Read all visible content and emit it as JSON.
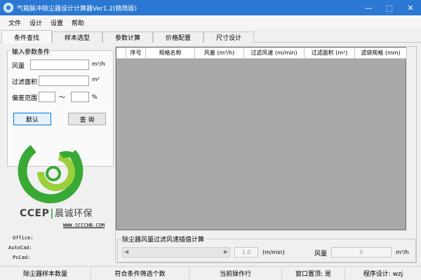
{
  "window": {
    "title": "气箱脉冲除尘器设计计算器Ver1.2(精简版)",
    "minimize_glyph": "—",
    "maximize_glyph": "□",
    "close_glyph": "✕"
  },
  "menu": [
    "文件",
    "设计",
    "设置",
    "帮助"
  ],
  "tabs": [
    "条件查找",
    "样本选型",
    "参数计算",
    "价格配置",
    "尺寸设计"
  ],
  "active_tab": 0,
  "search": {
    "group_title": "输入参数条件",
    "airflow_label": "风量",
    "airflow_unit": "m³/h",
    "airflow_value": "",
    "area_label": "过滤面积",
    "area_unit": "m²",
    "area_value": "",
    "range_label": "偏差范围",
    "range_min": "",
    "range_sep": "～",
    "range_max": "",
    "range_unit": "%",
    "default_button": "默认",
    "query_button": "查 询"
  },
  "brand": {
    "latin": "CCEP",
    "separator": "|",
    "chinese": "晨诚环保",
    "website": "WWW.SCCCHB.COM",
    "colors": {
      "green": "#39a935",
      "light_green": "#9ccf3c"
    }
  },
  "info": {
    "office_label": "Office:",
    "autocad_label": "AutoCad:",
    "pccad_label": "PcCad:"
  },
  "table": {
    "columns": [
      "",
      "序号",
      "规格名称",
      "风量 (m³/h)",
      "过滤风速 (m/min)",
      "过滤面积 (m²)",
      "滤袋规格 (mm)"
    ]
  },
  "interpolation": {
    "title": "除尘器风量过滤风速插值计算",
    "speed_value": "1.0",
    "speed_unit": "(m/min)",
    "airflow_label": "风量",
    "airflow_value": "0",
    "airflow_unit": "m³/h"
  },
  "status": [
    "除尘器样本数量",
    "符合条件筛选个数",
    "当前操作行",
    "窗口置顶: 是",
    "程序设计: wzj"
  ]
}
